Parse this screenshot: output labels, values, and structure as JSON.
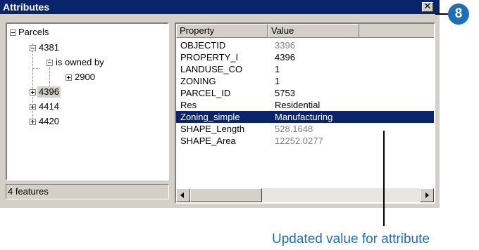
{
  "window": {
    "title": "Attributes",
    "close_glyph": "✕",
    "close_icon": "close-icon"
  },
  "tree": {
    "root_label": "Parcels",
    "nodes": [
      {
        "label": "4381",
        "state": "expanded"
      },
      {
        "label": "is owned by",
        "state": "expanded"
      },
      {
        "label": "2900",
        "state": "collapsed"
      },
      {
        "label": "4396",
        "state": "collapsed",
        "selected": true
      },
      {
        "label": "4414",
        "state": "collapsed"
      },
      {
        "label": "4420",
        "state": "collapsed"
      }
    ]
  },
  "status": {
    "text": "4 features"
  },
  "grid": {
    "columns": [
      "Property",
      "Value"
    ],
    "rows": [
      {
        "property": "OBJECTID",
        "value": "3396",
        "readonly": true
      },
      {
        "property": "PROPERTY_I",
        "value": "4396"
      },
      {
        "property": "LANDUSE_CO",
        "value": "1"
      },
      {
        "property": "ZONING",
        "value": "1"
      },
      {
        "property": "PARCEL_ID",
        "value": "5753"
      },
      {
        "property": "Res",
        "value": "Residential"
      },
      {
        "property": "Zoning_simple",
        "value": "Manufacturing",
        "selected": true
      },
      {
        "property": "SHAPE_Length",
        "value": "528.1648",
        "readonly": true
      },
      {
        "property": "SHAPE_Area",
        "value": "12252.0277",
        "readonly": true
      }
    ]
  },
  "callout": {
    "number": "8",
    "annotation": "Updated value for attribute"
  },
  "colors": {
    "title_bar": "#0a246a",
    "selection": "#0a246a",
    "callout": "#1f6fb8",
    "panel": "#d4d0c8"
  }
}
